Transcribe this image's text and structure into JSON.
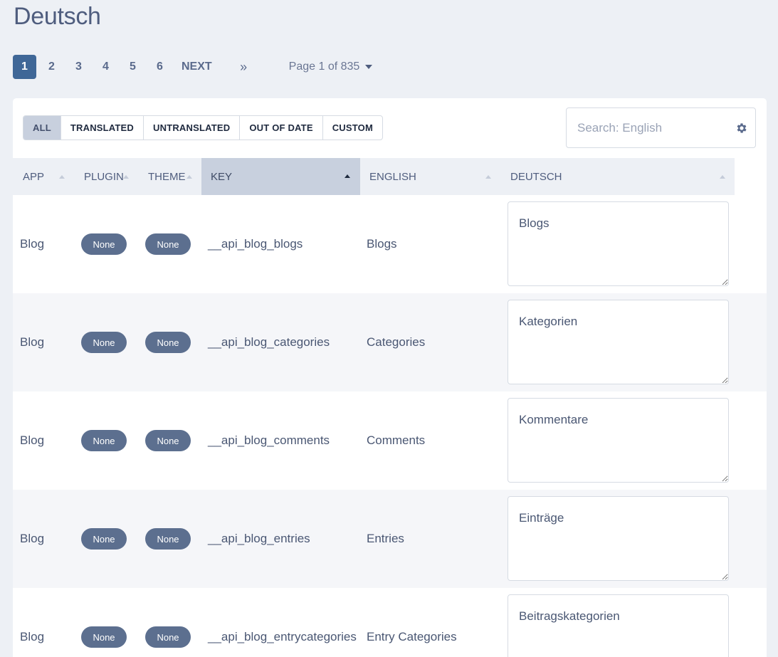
{
  "page": {
    "title": "Deutsch"
  },
  "pagination": {
    "pages": [
      "1",
      "2",
      "3",
      "4",
      "5",
      "6"
    ],
    "next_label": "NEXT",
    "last_label": "»",
    "page_of": "Page 1 of 835"
  },
  "filters": [
    "ALL",
    "TRANSLATED",
    "UNTRANSLATED",
    "OUT OF DATE",
    "CUSTOM"
  ],
  "search": {
    "placeholder": "Search: English",
    "icon": "gear-icon"
  },
  "columns": [
    "APP",
    "PLUGIN",
    "THEME",
    "KEY",
    "ENGLISH",
    "DEUTSCH"
  ],
  "sorted_column": "KEY",
  "rows": [
    {
      "app": "Blog",
      "plugin": "None",
      "theme": "None",
      "key": "__api_blog_blogs",
      "english": "Blogs",
      "deutsch": "Blogs"
    },
    {
      "app": "Blog",
      "plugin": "None",
      "theme": "None",
      "key": "__api_blog_categories",
      "english": "Categories",
      "deutsch": "Kategorien"
    },
    {
      "app": "Blog",
      "plugin": "None",
      "theme": "None",
      "key": "__api_blog_comments",
      "english": "Comments",
      "deutsch": "Kommentare"
    },
    {
      "app": "Blog",
      "plugin": "None",
      "theme": "None",
      "key": "__api_blog_entries",
      "english": "Entries",
      "deutsch": "Einträge"
    },
    {
      "app": "Blog",
      "plugin": "None",
      "theme": "None",
      "key": "__api_blog_entrycategories",
      "english": "Entry Categories",
      "deutsch": "Beitragskategorien"
    }
  ],
  "colors": {
    "accent": "#3f6797",
    "pill": "#5c6f8f",
    "sorted_header": "#c8d0de",
    "background": "#edf0f5"
  }
}
